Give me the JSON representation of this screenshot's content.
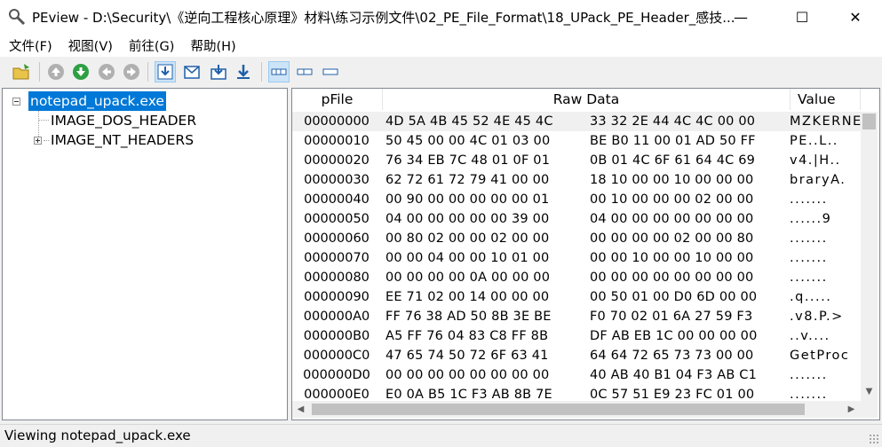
{
  "window": {
    "title": "PEview - D:\\Security\\《逆向工程核心原理》材料\\练习示例文件\\02_PE_File_Format\\18_UPack_PE_Header_感技...",
    "minimize": "—",
    "maximize": "☐",
    "close": "✕"
  },
  "menu": [
    "文件(F)",
    "视图(V)",
    "前往(G)",
    "帮助(H)"
  ],
  "tree": {
    "root": "notepad_upack.exe",
    "children": [
      "IMAGE_DOS_HEADER",
      "IMAGE_NT_HEADERS"
    ]
  },
  "columns": {
    "offset": "pFile",
    "raw": "Raw Data",
    "value": "Value"
  },
  "rows": [
    {
      "off": "00000000",
      "h1": "4D 5A 4B 45 52 4E 45 4C",
      "h2": "33 32 2E 44 4C 4C 00 00",
      "val": "MZKERNE"
    },
    {
      "off": "00000010",
      "h1": "50 45 00 00 4C 01 03 00",
      "h2": "BE B0 11 00 01 AD 50 FF",
      "val": "PE..L.."
    },
    {
      "off": "00000020",
      "h1": "76 34 EB 7C 48 01 0F 01",
      "h2": "0B 01 4C 6F 61 64 4C 69",
      "val": "v4.|H.."
    },
    {
      "off": "00000030",
      "h1": "62 72 61 72 79 41 00 00",
      "h2": "18 10 00 00 10 00 00 00",
      "val": "braryA."
    },
    {
      "off": "00000040",
      "h1": "00 90 00 00 00 00 00 01",
      "h2": "00 10 00 00 00 02 00 00",
      "val": "......."
    },
    {
      "off": "00000050",
      "h1": "04 00 00 00 00 00 39 00",
      "h2": "04 00 00 00 00 00 00 00",
      "val": "......9"
    },
    {
      "off": "00000060",
      "h1": "00 80 02 00 00 02 00 00",
      "h2": "00 00 00 00 02 00 00 80",
      "val": "......."
    },
    {
      "off": "00000070",
      "h1": "00 00 04 00 00 10 01 00",
      "h2": "00 00 10 00 00 10 00 00",
      "val": "......."
    },
    {
      "off": "00000080",
      "h1": "00 00 00 00 0A 00 00 00",
      "h2": "00 00 00 00 00 00 00 00",
      "val": "......."
    },
    {
      "off": "00000090",
      "h1": "EE 71 02 00 14 00 00 00",
      "h2": "00 50 01 00 D0 6D 00 00",
      "val": ".q....."
    },
    {
      "off": "000000A0",
      "h1": "FF 76 38 AD 50 8B 3E BE",
      "h2": "F0 70 02 01 6A 27 59 F3",
      "val": ".v8.P.>"
    },
    {
      "off": "000000B0",
      "h1": "A5 FF 76 04 83 C8 FF 8B",
      "h2": "DF AB EB 1C 00 00 00 00",
      "val": "..v...."
    },
    {
      "off": "000000C0",
      "h1": "47 65 74 50 72 6F 63 41",
      "h2": "64 64 72 65 73 73 00 00",
      "val": "GetProc"
    },
    {
      "off": "000000D0",
      "h1": "00 00 00 00 00 00 00 00",
      "h2": "40 AB 40 B1 04 F3 AB C1",
      "val": "......."
    },
    {
      "off": "000000E0",
      "h1": "E0 0A B5 1C F3 AB 8B 7E",
      "h2": "0C 57 51 E9 23 FC 01 00",
      "val": "......."
    }
  ],
  "status": "Viewing notepad_upack.exe"
}
